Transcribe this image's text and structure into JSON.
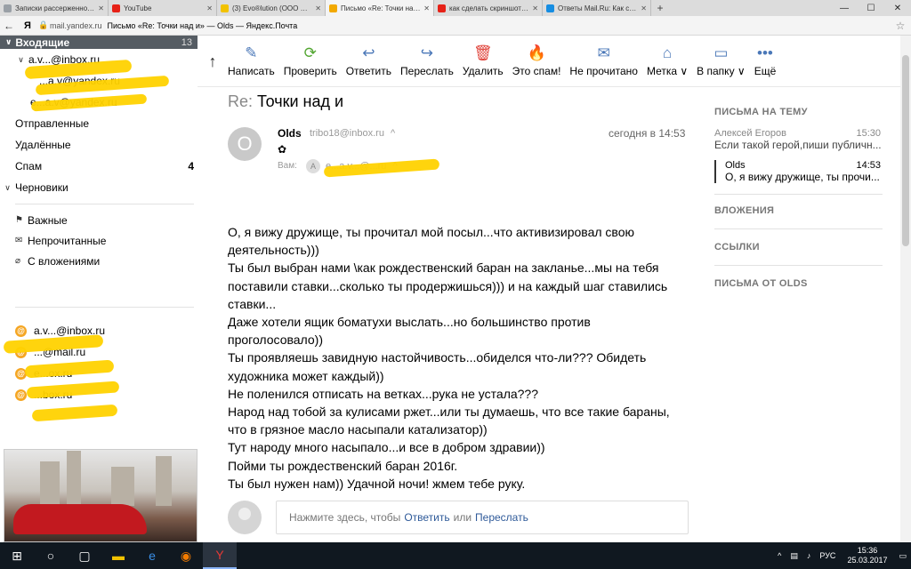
{
  "browser": {
    "tabs": [
      {
        "title": "Записки рассерженного о...",
        "color": "#9aa0a6",
        "active": false
      },
      {
        "title": "YouTube",
        "color": "#e62117",
        "active": false
      },
      {
        "title": "(3) Evo®lution (ООО НВФ...",
        "color": "#f2c200",
        "active": false
      },
      {
        "title": "Письмо «Re: Точки над и...",
        "color": "#f2a900",
        "active": true
      },
      {
        "title": "как сделать скриншот экр...",
        "color": "#e62117",
        "active": false
      },
      {
        "title": "Ответы Mail.Ru: Как сделат...",
        "color": "#168de2",
        "active": false
      }
    ],
    "url_domain": "mail.yandex.ru",
    "page_title": "Письмо «Re: Точки над и» — Olds — Яндекс.Почта",
    "logo": "Я"
  },
  "sidebar": {
    "inbox": {
      "label": "Входящие",
      "count": "13"
    },
    "inbox_subs": [
      "a.v...@inbox.ru",
      "...a.v@yandex.ru",
      "e...a.v@yandex.ru"
    ],
    "folders": [
      {
        "label": "Отправленные",
        "count": ""
      },
      {
        "label": "Удалённые",
        "count": ""
      },
      {
        "label": "Спам",
        "count": "4"
      }
    ],
    "drafts": "Черновики",
    "labels": [
      {
        "label": "Важные",
        "icon": "flag-icon"
      },
      {
        "label": "Непрочитанные",
        "icon": "envelope-icon"
      },
      {
        "label": "С вложениями",
        "icon": "paperclip-icon"
      }
    ],
    "accounts": [
      "a.v...@inbox.ru",
      "...@mail.ru",
      "e...ox.ru",
      "...box.ru"
    ]
  },
  "toolbar": {
    "buttons": [
      {
        "label": "Написать",
        "icon": "compose-icon",
        "glyph": "✎",
        "color": "#4b78b8"
      },
      {
        "label": "Проверить",
        "icon": "refresh-icon",
        "glyph": "⟳",
        "color": "#53a632"
      },
      {
        "label": "Ответить",
        "icon": "reply-icon",
        "glyph": "↩",
        "color": "#4b78b8"
      },
      {
        "label": "Переслать",
        "icon": "forward-icon",
        "glyph": "↪",
        "color": "#4b78b8"
      },
      {
        "label": "Удалить",
        "icon": "trash-icon",
        "glyph": "🗑",
        "color": "#e0433a"
      },
      {
        "label": "Это спам!",
        "icon": "spam-icon",
        "glyph": "🔥",
        "color": "#f5a623"
      },
      {
        "label": "Не прочитано",
        "icon": "unread-icon",
        "glyph": "✉",
        "color": "#4b78b8"
      },
      {
        "label": "Метка ∨",
        "icon": "tag-icon",
        "glyph": "⌂",
        "color": "#4b78b8"
      },
      {
        "label": "В папку ∨",
        "icon": "folder-icon",
        "glyph": "▭",
        "color": "#4b78b8"
      },
      {
        "label": "Ещё",
        "icon": "more-icon",
        "glyph": "•••",
        "color": "#4b78b8"
      }
    ]
  },
  "message": {
    "subject_prefix": "Re:",
    "subject": "Точки над и",
    "avatar_letter": "O",
    "from_name": "Olds",
    "from_addr": "tribo18@inbox.ru",
    "date": "сегодня в 14:53",
    "to_label": "Вам:",
    "to_chip": "A",
    "to_addr": "e...a.v...@...ru",
    "body": [
      "О, я вижу дружище, ты прочитал мой посыл...что активизировал свою деятельность)))",
      "Ты был выбран нами  \\как рождественский баран на закланье...мы на тебя поставили ставки...сколько ты продержишься))) и на каждый шаг ставились ставки...",
      "Даже хотели ящик боматухи выслать...но большинство против проголосовало))",
      "Ты проявляешь завидную настойчивость...обиделся что-ли??? Обидеть художника может каждый))",
      "Не поленился отписать на ветках...рука не устала???",
      "Народ над тобой за кулисами ржет...или ты думаешь, что все такие бараны, что в грязное масло насыпали катализатор))",
      "Тут народу много насыпало...и все в добром здравии))",
      "Пойми ты рождественский баран 2016г.",
      "Ты был нужен нам)) Удачной ночи! жмем тебе руку."
    ],
    "reply_prompt": "Нажмите здесь, чтобы",
    "reply_link": "Ответить",
    "reply_or": "или",
    "forward_link": "Переслать"
  },
  "right_panel": {
    "thread_title": "ПИСЬМА НА ТЕМУ",
    "thread": [
      {
        "name": "Алексей Егоров",
        "time": "15:30",
        "snippet": "Если такой герой,пиши публичн...",
        "active": false
      },
      {
        "name": "Olds",
        "time": "14:53",
        "snippet": "О, я вижу дружище, ты прочи...",
        "active": true
      }
    ],
    "attachments": "ВЛОЖЕНИЯ",
    "links": "ССЫЛКИ",
    "from_olds": "ПИСЬМА ОТ OLDS"
  },
  "taskbar": {
    "lang": "РУС",
    "time": "15:36",
    "date": "25.03.2017"
  }
}
